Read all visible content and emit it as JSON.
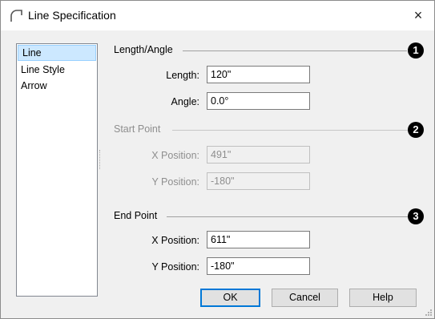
{
  "window": {
    "title": "Line Specification",
    "close_glyph": "×"
  },
  "sidebar": {
    "items": [
      {
        "label": "Line",
        "selected": true
      },
      {
        "label": "Line Style",
        "selected": false
      },
      {
        "label": "Arrow",
        "selected": false
      }
    ]
  },
  "sections": {
    "length_angle": {
      "title": "Length/Angle",
      "badge": "1",
      "length_label": "Length:",
      "length_value": "120\"",
      "angle_label": "Angle:",
      "angle_value": "0.0°"
    },
    "start_point": {
      "title": "Start Point",
      "badge": "2",
      "disabled": true,
      "x_label": "X Position:",
      "x_value": "491\"",
      "y_label": "Y Position:",
      "y_value": "-180\""
    },
    "end_point": {
      "title": "End Point",
      "badge": "3",
      "x_label": "X Position:",
      "x_value": "611\"",
      "y_label": "Y Position:",
      "y_value": "-180\""
    }
  },
  "buttons": {
    "ok": "OK",
    "cancel": "Cancel",
    "help": "Help"
  },
  "icons": {
    "title": "arc-icon",
    "close": "close-icon",
    "grip": "resize-grip-icon"
  },
  "colors": {
    "selection": "#cce8ff",
    "default_button_border": "#0078d7",
    "badge": "#000000"
  }
}
